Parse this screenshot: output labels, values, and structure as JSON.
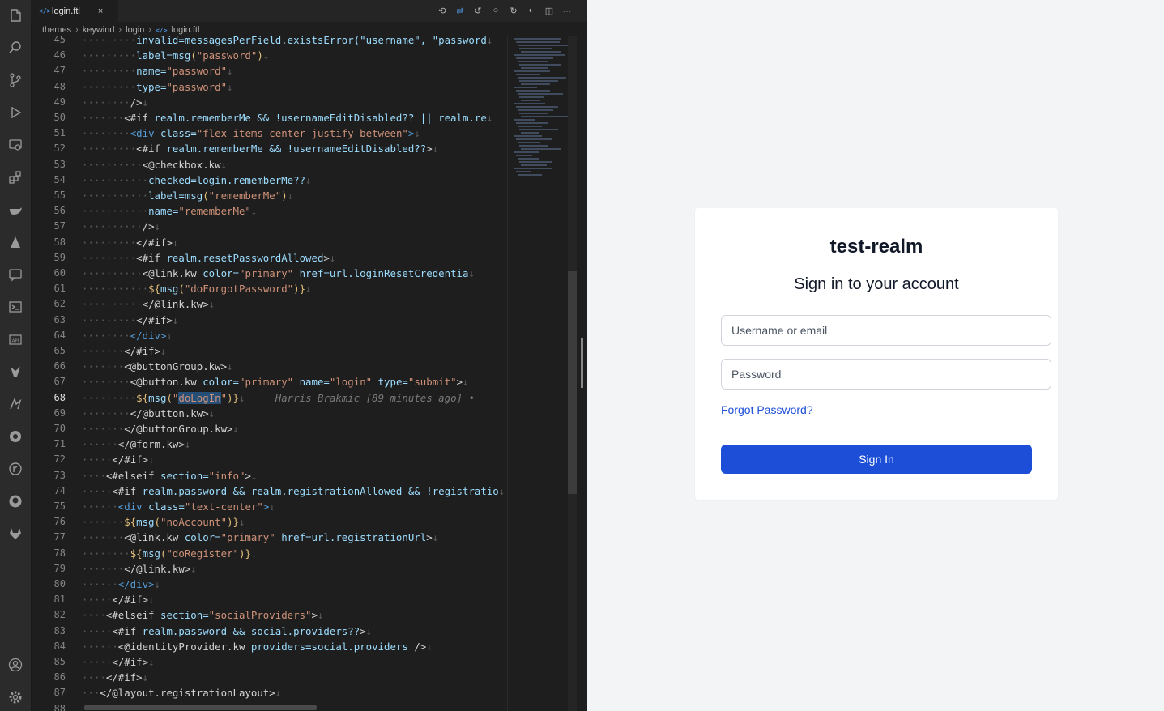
{
  "editor": {
    "tab": {
      "filename": "login.ftl",
      "close": "×"
    },
    "breadcrumb": [
      "themes",
      "keywind",
      "login",
      "login.ftl"
    ],
    "current_line": 68,
    "blame": "Harris Brakmic [89 minutes ago] •",
    "lines": [
      [
        [
          "k-a",
          "invalid=messagesPerField.existsError(\"username\", \"password"
        ]
      ],
      [
        [
          "k-a",
          "label=msg"
        ],
        [
          "k-d",
          "("
        ],
        [
          "k-s",
          "\"password\""
        ],
        [
          "k-d",
          ")"
        ]
      ],
      [
        [
          "k-a",
          "name="
        ],
        [
          "k-s",
          "\"password\""
        ]
      ],
      [
        [
          "k-a",
          "type="
        ],
        [
          "k-s",
          "\"password\""
        ]
      ],
      [
        [
          "k-w",
          "/>"
        ]
      ],
      [
        [
          "k-w",
          "<#if "
        ],
        [
          "k-a",
          "realm.rememberMe && !usernameEditDisabled?? || realm.re"
        ]
      ],
      [
        [
          "k-t",
          "<div "
        ],
        [
          "k-a",
          "class="
        ],
        [
          "k-s",
          "\"flex items-center justify-between\""
        ],
        [
          "k-t",
          ">"
        ]
      ],
      [
        [
          "k-w",
          "<#if "
        ],
        [
          "k-a",
          "realm.rememberMe && !usernameEditDisabled??"
        ],
        [
          "k-w",
          ">"
        ]
      ],
      [
        [
          "k-w",
          "<@checkbox.kw"
        ]
      ],
      [
        [
          "k-a",
          "checked=login.rememberMe??"
        ]
      ],
      [
        [
          "k-a",
          "label=msg"
        ],
        [
          "k-d",
          "("
        ],
        [
          "k-s",
          "\"rememberMe\""
        ],
        [
          "k-d",
          ")"
        ]
      ],
      [
        [
          "k-a",
          "name="
        ],
        [
          "k-s",
          "\"rememberMe\""
        ]
      ],
      [
        [
          "k-w",
          "/>"
        ]
      ],
      [
        [
          "k-w",
          "</#if>"
        ]
      ],
      [
        [
          "k-w",
          "<#if "
        ],
        [
          "k-a",
          "realm.resetPasswordAllowed"
        ],
        [
          "k-w",
          ">"
        ]
      ],
      [
        [
          "k-w",
          "<@link.kw "
        ],
        [
          "k-a",
          "color="
        ],
        [
          "k-s",
          "\"primary\""
        ],
        [
          "k-a",
          " href=url.loginResetCredentia"
        ]
      ],
      [
        [
          "k-d",
          "${"
        ],
        [
          "k-a",
          "msg"
        ],
        [
          "k-d",
          "("
        ],
        [
          "k-s",
          "\"doForgotPassword\""
        ],
        [
          "k-d",
          ")}"
        ]
      ],
      [
        [
          "k-w",
          "</@link.kw>"
        ]
      ],
      [
        [
          "k-w",
          "</#if>"
        ]
      ],
      [
        [
          "k-t",
          "</div>"
        ]
      ],
      [
        [
          "k-w",
          "</#if>"
        ]
      ],
      [
        [
          "k-w",
          "<@buttonGroup.kw>"
        ]
      ],
      [
        [
          "k-w",
          "<@button.kw "
        ],
        [
          "k-a",
          "color="
        ],
        [
          "k-s",
          "\"primary\""
        ],
        [
          "k-a",
          " name="
        ],
        [
          "k-s",
          "\"login\""
        ],
        [
          "k-a",
          " type="
        ],
        [
          "k-s",
          "\"submit\""
        ],
        [
          "k-w",
          ">"
        ]
      ],
      [
        [
          "k-d",
          "${"
        ],
        [
          "k-a",
          "msg"
        ],
        [
          "k-d",
          "("
        ],
        [
          "k-s",
          "\""
        ],
        [
          "sel k-s",
          "doLogIn"
        ],
        [
          "k-s",
          "\""
        ],
        [
          "k-d",
          ")}"
        ]
      ],
      [
        [
          "k-w",
          "</@button.kw>"
        ]
      ],
      [
        [
          "k-w",
          "</@buttonGroup.kw>"
        ]
      ],
      [
        [
          "k-w",
          "</@form.kw>"
        ]
      ],
      [
        [
          "k-w",
          "</#if>"
        ]
      ],
      [
        [
          "k-w",
          "<#elseif "
        ],
        [
          "k-a",
          "section="
        ],
        [
          "k-s",
          "\"info\""
        ],
        [
          "k-w",
          ">"
        ]
      ],
      [
        [
          "k-w",
          "<#if "
        ],
        [
          "k-a",
          "realm.password && realm.registrationAllowed && !registratio"
        ]
      ],
      [
        [
          "k-t",
          "<div "
        ],
        [
          "k-a",
          "class="
        ],
        [
          "k-s",
          "\"text-center\""
        ],
        [
          "k-t",
          ">"
        ]
      ],
      [
        [
          "k-d",
          "${"
        ],
        [
          "k-a",
          "msg"
        ],
        [
          "k-d",
          "("
        ],
        [
          "k-s",
          "\"noAccount\""
        ],
        [
          "k-d",
          ")}"
        ]
      ],
      [
        [
          "k-w",
          "<@link.kw "
        ],
        [
          "k-a",
          "color="
        ],
        [
          "k-s",
          "\"primary\""
        ],
        [
          "k-a",
          " href=url.registrationUrl"
        ],
        [
          "k-w",
          ">"
        ]
      ],
      [
        [
          "k-d",
          "${"
        ],
        [
          "k-a",
          "msg"
        ],
        [
          "k-d",
          "("
        ],
        [
          "k-s",
          "\"doRegister\""
        ],
        [
          "k-d",
          ")}"
        ]
      ],
      [
        [
          "k-w",
          "</@link.kw>"
        ]
      ],
      [
        [
          "k-t",
          "</div>"
        ]
      ],
      [
        [
          "k-w",
          "</#if>"
        ]
      ],
      [
        [
          "k-w",
          "<#elseif "
        ],
        [
          "k-a",
          "section="
        ],
        [
          "k-s",
          "\"socialProviders\""
        ],
        [
          "k-w",
          ">"
        ]
      ],
      [
        [
          "k-w",
          "<#if "
        ],
        [
          "k-a",
          "realm.password && social.providers??"
        ],
        [
          "k-w",
          ">"
        ]
      ],
      [
        [
          "k-w",
          "<@identityProvider.kw "
        ],
        [
          "k-a",
          "providers=social.providers"
        ],
        [
          "k-w",
          " />"
        ]
      ],
      [
        [
          "k-w",
          "</#if>"
        ]
      ],
      [
        [
          "k-w",
          "</#if>"
        ]
      ],
      [
        [
          "k-w",
          "</@layout.registrationLayout>"
        ]
      ],
      []
    ]
  },
  "login": {
    "realm_title": "test-realm",
    "heading": "Sign in to your account",
    "username_placeholder": "Username or email",
    "password_placeholder": "Password",
    "forgot_link": "Forgot Password?",
    "signin_button": "Sign In",
    "accent": "#1d4ed8"
  }
}
